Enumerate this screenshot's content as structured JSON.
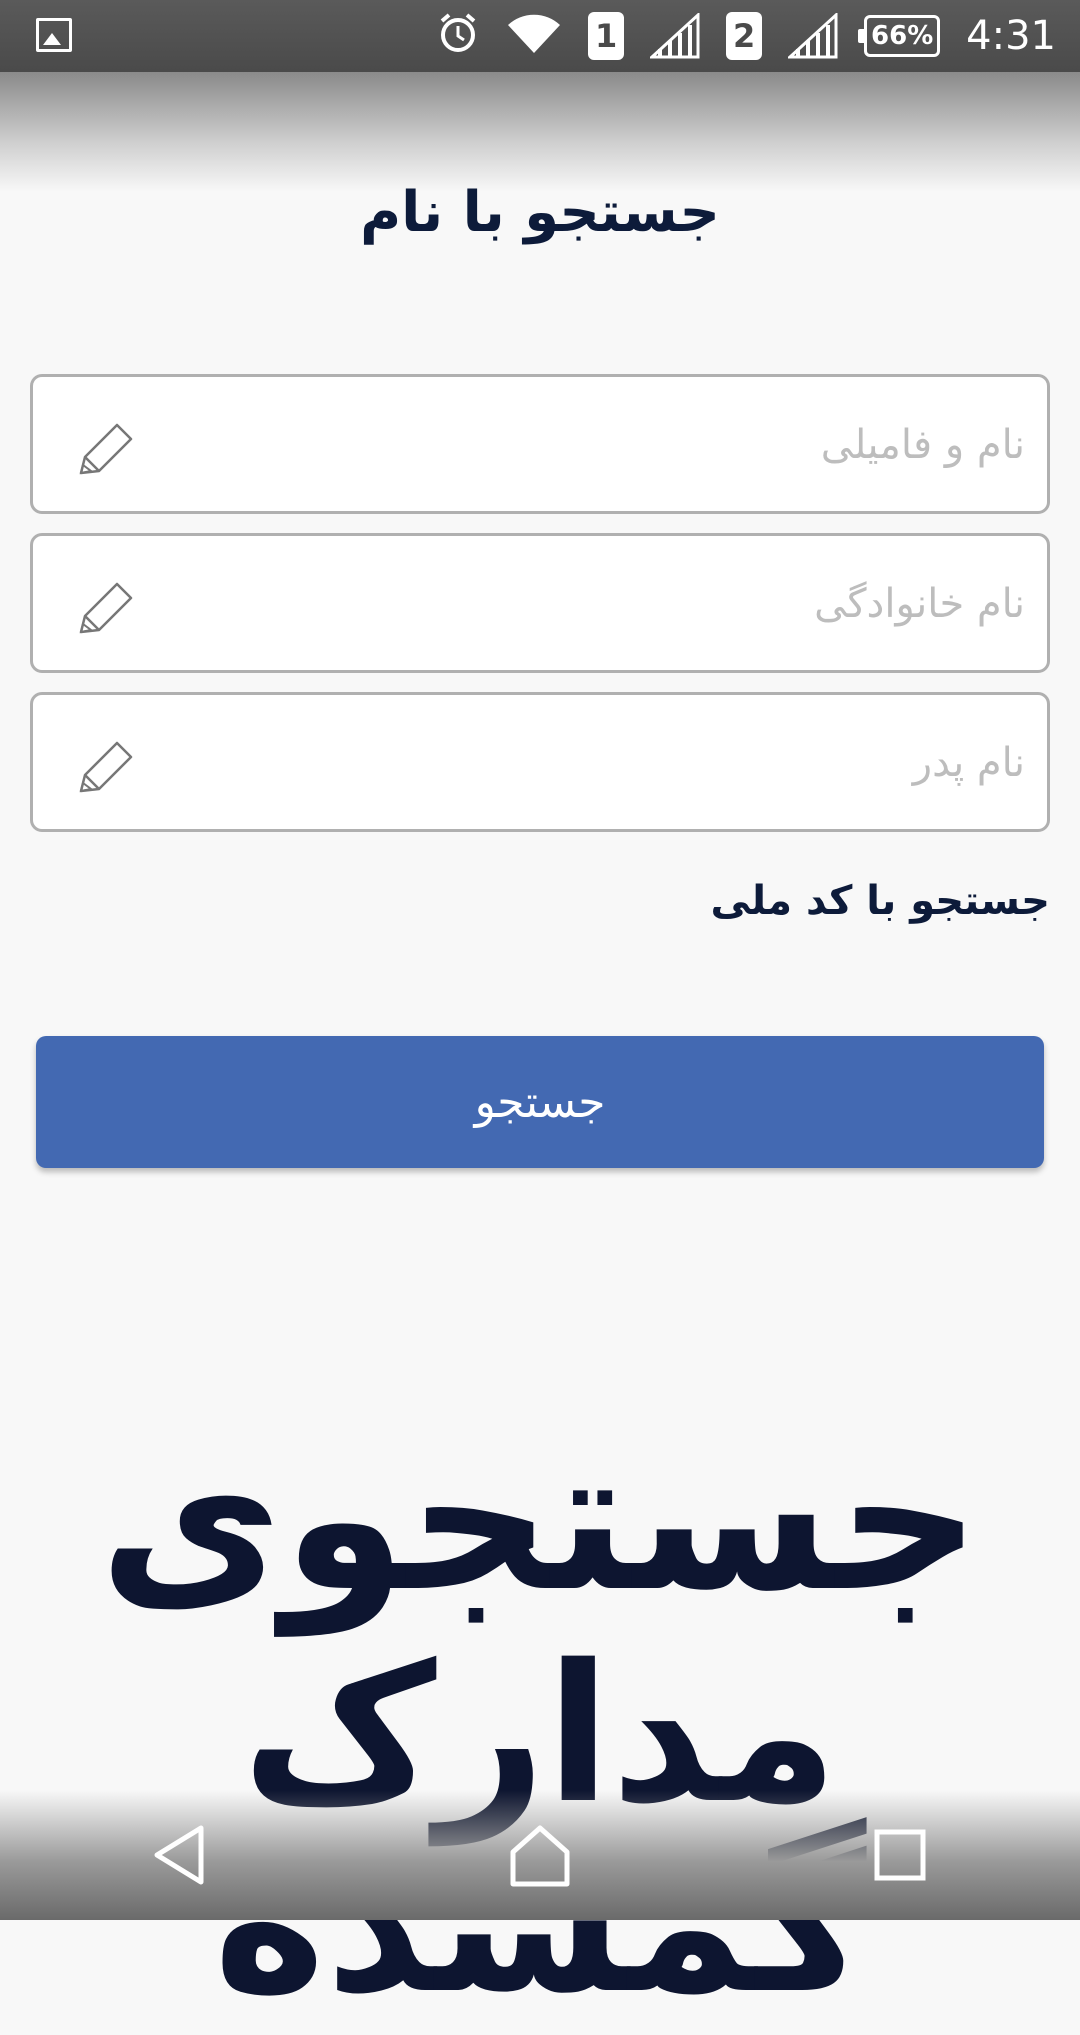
{
  "status_bar": {
    "sim1": "1",
    "sim2": "2",
    "battery": "66%",
    "time": "4:31",
    "icons": [
      "image-icon",
      "alarm-icon",
      "wifi-icon",
      "signal-icon",
      "battery-icon"
    ]
  },
  "page": {
    "title": "جستجو با نام",
    "fields": [
      {
        "placeholder": "نام و فامیلی",
        "value": ""
      },
      {
        "placeholder": "نام خانوادگی",
        "value": ""
      },
      {
        "placeholder": "نام پدر",
        "value": ""
      }
    ],
    "switch_link": "جستجو با کد ملی",
    "search_button": "جستجو"
  },
  "brand": {
    "line1": "جستجوی",
    "line2": "مدارک گمشده"
  },
  "colors": {
    "accent": "#4369b2",
    "title": "#0d1b3a",
    "background": "#f8f8f8"
  }
}
